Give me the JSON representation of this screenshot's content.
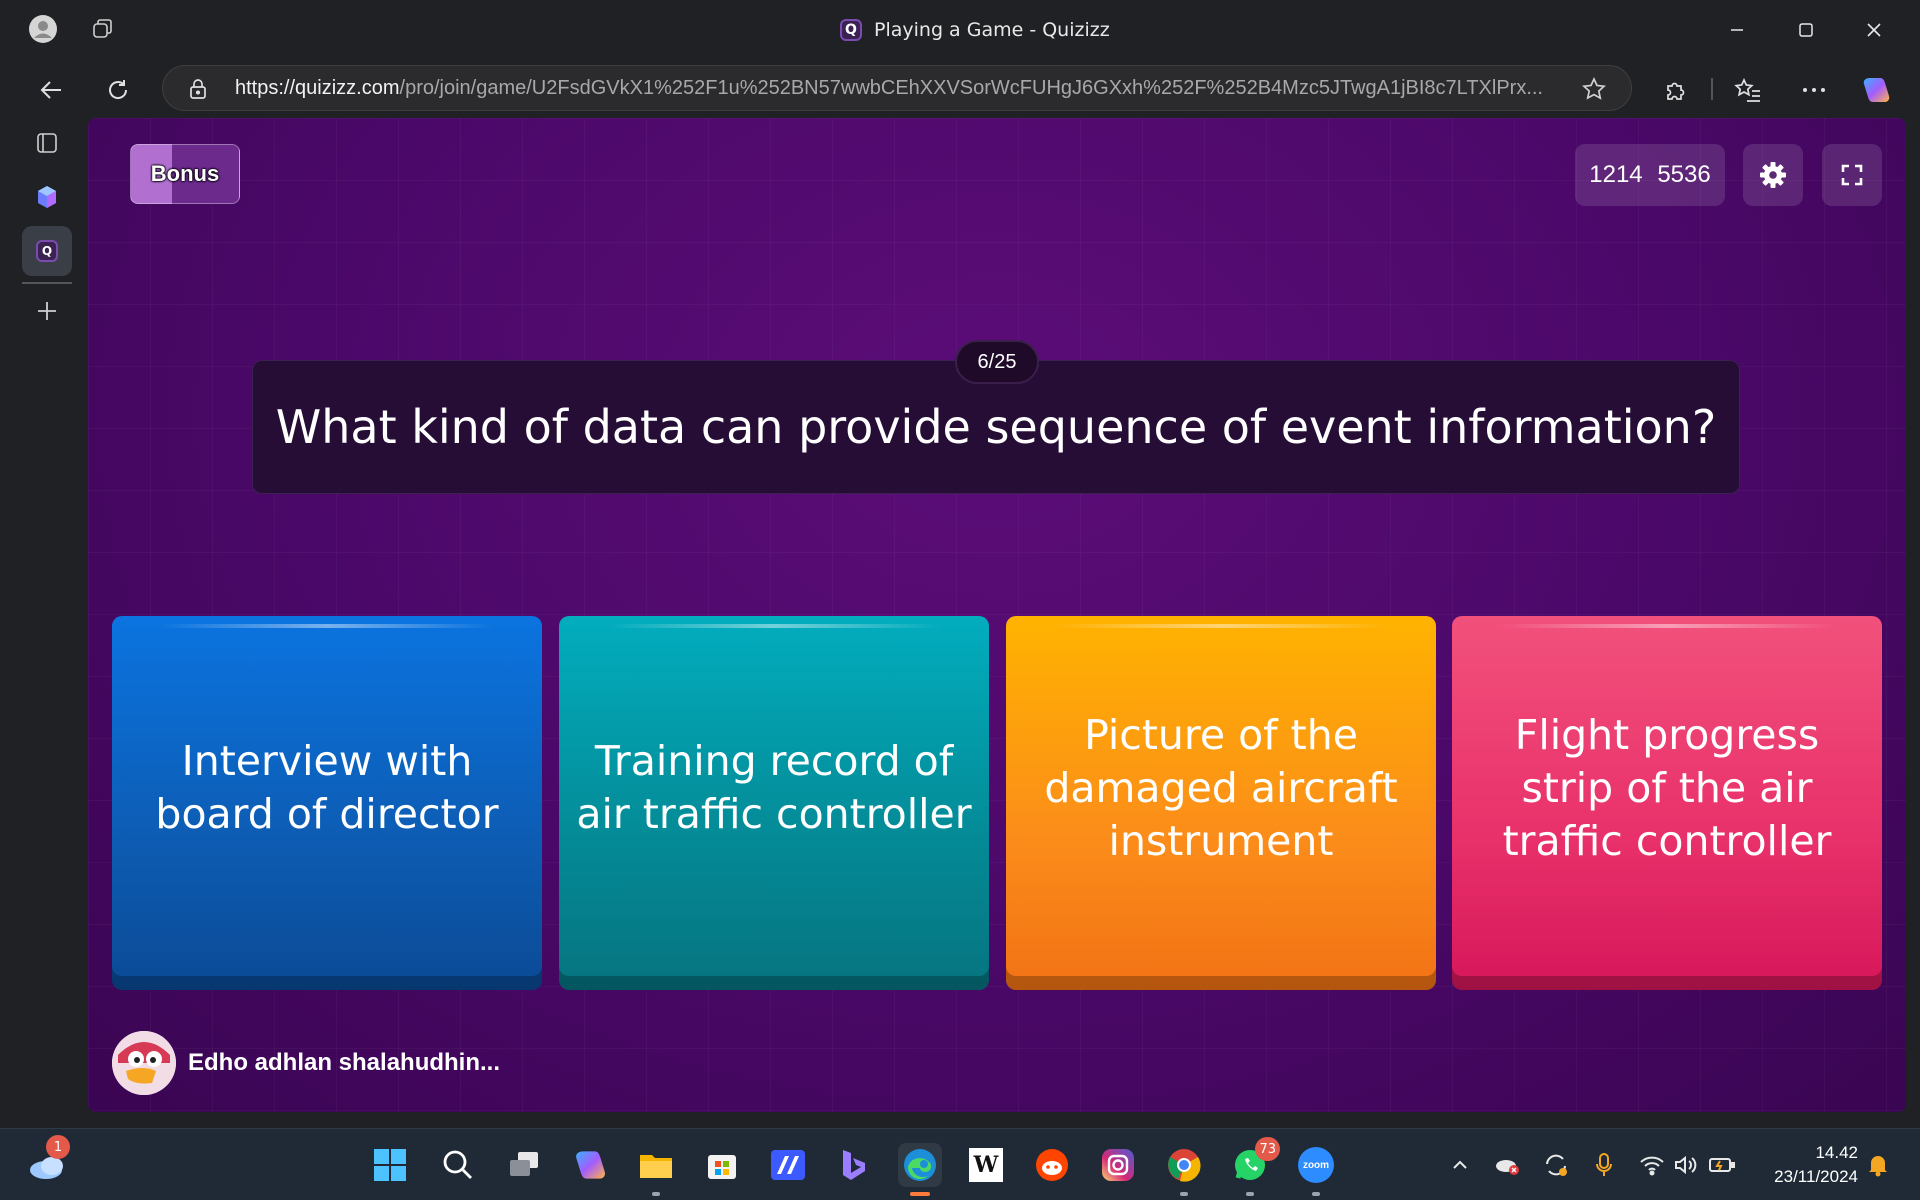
{
  "browser": {
    "tab_title": "Playing a Game - Quizizz",
    "tab_logo": "Q",
    "url_domain": "https://quizizz.com",
    "url_path": "/pro/join/game/U2FsdGVkX1%252F1u%252BN57wwbCEhXXVSorWcFUHgJ6GXxh%252F%252B4Mzc5JTwgA1jBI8c7LTXlPrx...",
    "icons": {
      "profile": "profile-icon",
      "workspaces": "workspaces-icon",
      "back": "back-arrow-icon",
      "refresh": "refresh-icon",
      "lock": "lock-icon",
      "favorite": "star-icon",
      "extensions": "puzzle-icon",
      "favorites": "favorites-list-icon",
      "more": "more-icon",
      "copilot": "copilot-icon"
    }
  },
  "sidebar": {
    "items": [
      {
        "name": "tab-actions-icon"
      },
      {
        "name": "copilot-cube-icon"
      },
      {
        "name": "quizizz-tab-icon",
        "label": "Q"
      },
      {
        "name": "add-tab-icon"
      }
    ]
  },
  "game": {
    "bonus_label": "Bonus",
    "join_code": "1214 5536",
    "question_counter": "6/25",
    "question": "What kind of data can provide sequence of event information?",
    "options": [
      {
        "text": "Interview with board of director",
        "color": "#0d5cb3"
      },
      {
        "text": "Training record of air traffic controller",
        "color": "#048a96"
      },
      {
        "text": "Picture of the damaged aircraft instrument",
        "color": "#fb8c1a"
      },
      {
        "text": "Flight progress strip of the air traffic controller",
        "color": "#e8306a"
      }
    ],
    "player_name": "Edho adhlan shalahudhin..."
  },
  "taskbar": {
    "weather_badge": "1",
    "whatsapp_badge": "73",
    "wikipedia_label": "W",
    "zoom_label": "zoom",
    "time": "14.42",
    "date": "23/11/2024"
  }
}
